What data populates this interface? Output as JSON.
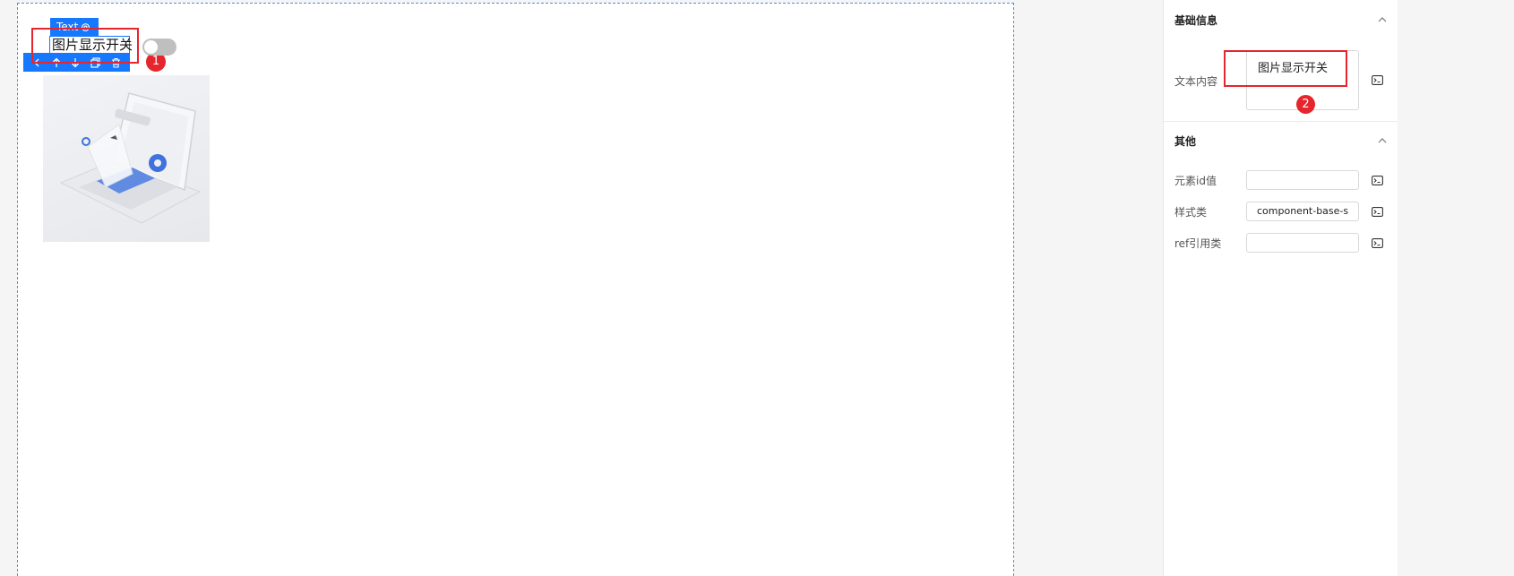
{
  "canvas": {
    "component_tag": "Text",
    "selected_text": "图片显示开关",
    "annotations": [
      "1",
      "2"
    ]
  },
  "toolbar": {
    "icons": [
      "arrow-back-icon",
      "arrow-up-icon",
      "arrow-down-icon",
      "copy-icon",
      "delete-icon"
    ]
  },
  "panel": {
    "basic_section": {
      "title": "基础信息",
      "text_content_label": "文本内容",
      "text_content_value": "图片显示开关"
    },
    "other_section": {
      "title": "其他",
      "id_label": "元素id值",
      "id_value": "",
      "class_label": "样式类",
      "class_value": "component-base-s",
      "ref_label": "ref引用类",
      "ref_value": ""
    }
  },
  "colors": {
    "accent": "#1677ff",
    "annotation": "#e6252c",
    "switch_off": "#bfbfbf"
  }
}
